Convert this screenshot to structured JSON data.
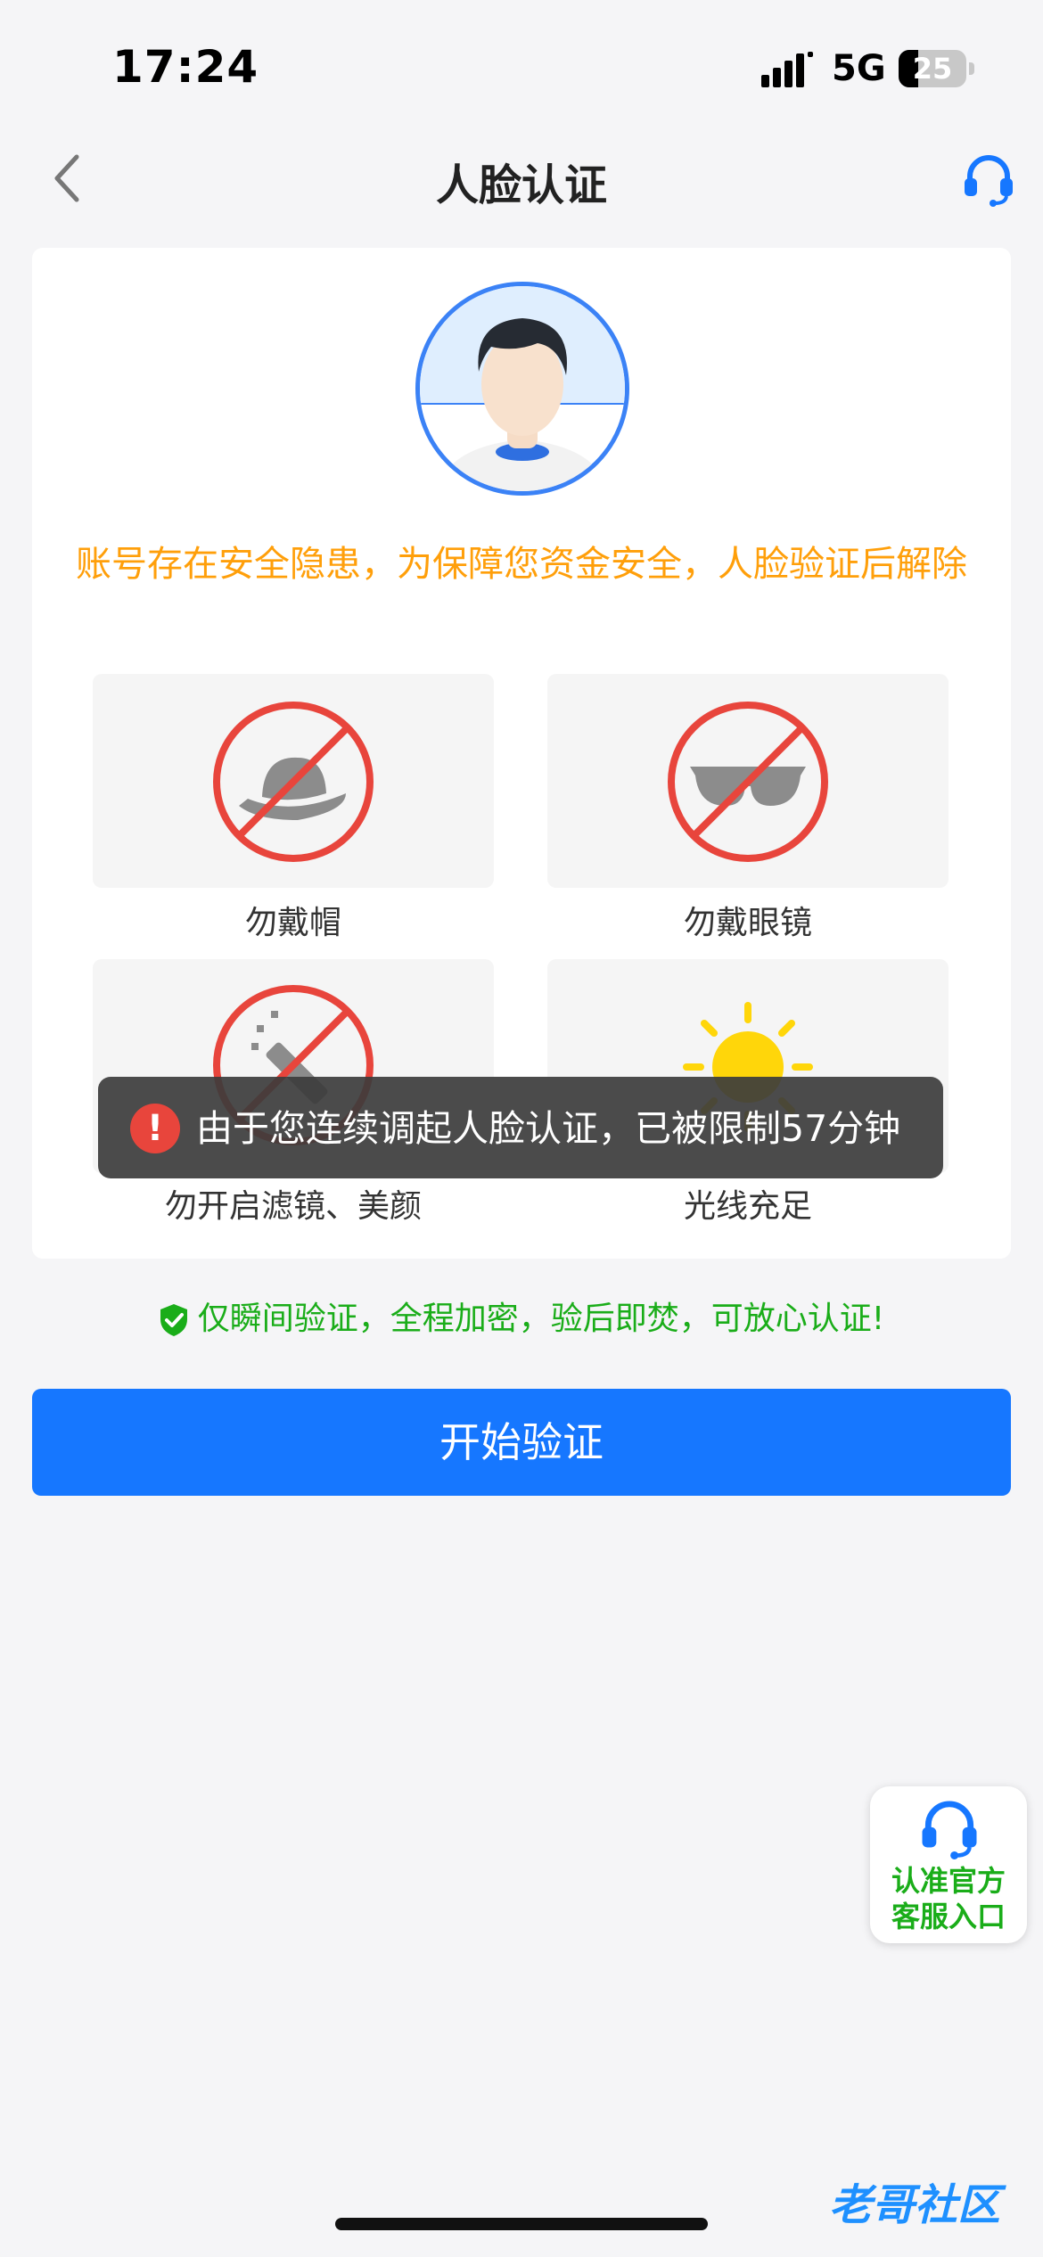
{
  "status_bar": {
    "time": "17:24",
    "network": "5G",
    "battery": "25"
  },
  "nav": {
    "title": "人脸认证",
    "back_icon": "chevron-left-icon",
    "support_icon": "headset-icon"
  },
  "warning": "账号存在安全隐患，为保障您资金安全，人脸验证后解除",
  "tips": [
    {
      "label": "勿戴帽",
      "icon": "no-hat-icon"
    },
    {
      "label": "勿戴眼镜",
      "icon": "no-glasses-icon"
    },
    {
      "label": "勿开启滤镜、美颜",
      "icon": "no-filter-icon"
    },
    {
      "label": "光线充足",
      "icon": "sun-icon"
    }
  ],
  "toast": {
    "text": "由于您连续调起人脸认证，已被限制57分钟",
    "icon": "error-icon"
  },
  "assurance": "仅瞬间验证，全程加密，验后即焚，可放心认证!",
  "start_button": "开始验证",
  "float_support": {
    "line1": "认准官方",
    "line2": "客服入口"
  },
  "watermark": "老哥社区",
  "colors": {
    "accent": "#1677ff",
    "warning": "#ff9f0a",
    "success": "#1aad19",
    "prohibit": "#e8453c"
  }
}
